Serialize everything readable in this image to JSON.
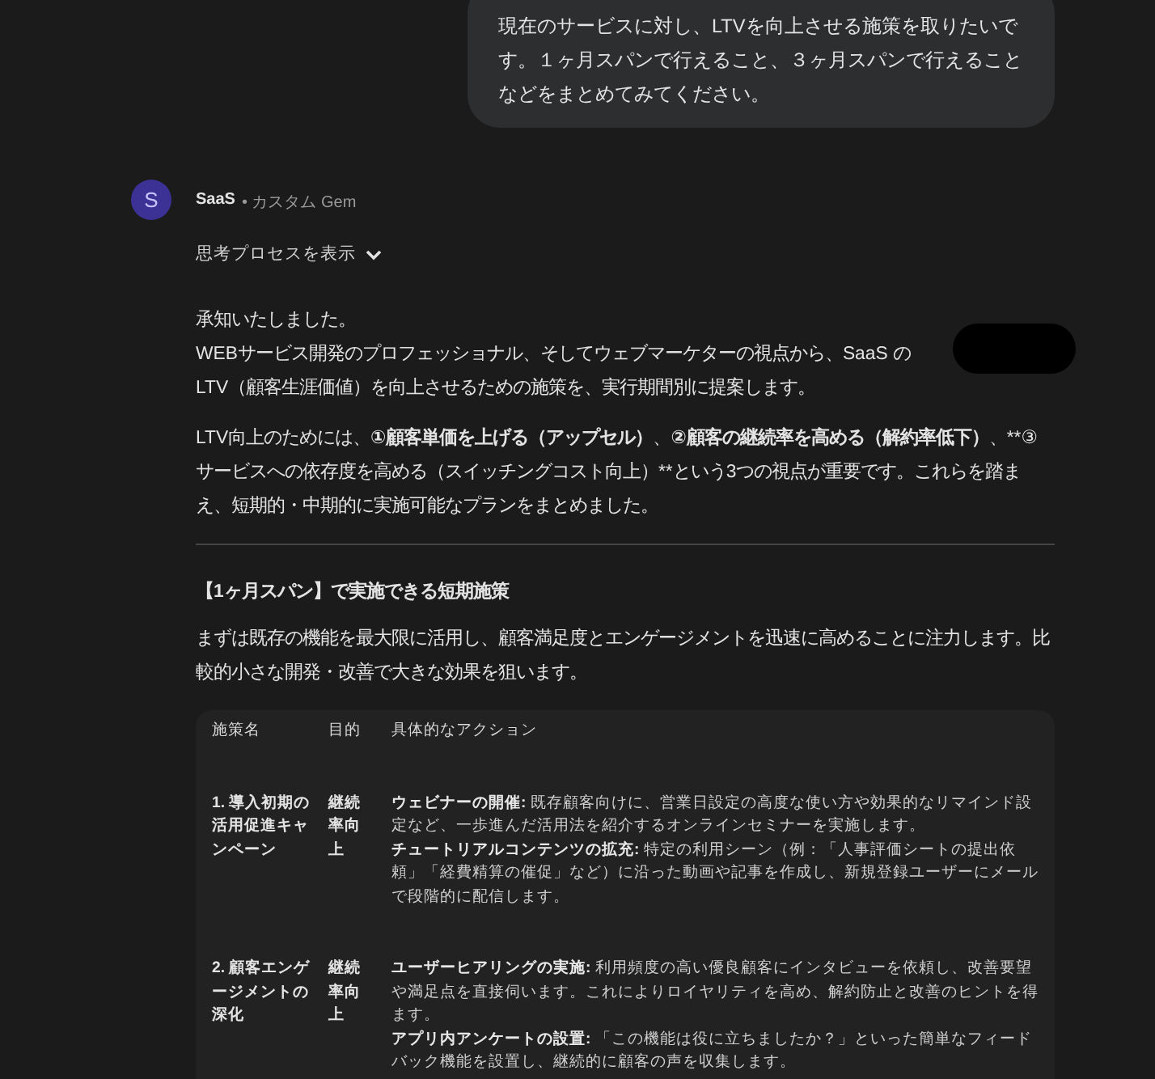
{
  "user_message": "現在のサービスに対し、LTVを向上させる施策を取りたいです。１ヶ月スパンで行えること、３ヶ月スパンで行えることなどをまとめてみてください。",
  "response": {
    "avatar": "S",
    "author": "SaaS",
    "author_suffix": "• カスタム Gem",
    "thinking_toggle": "思考プロセスを表示",
    "thinking_expanded": false,
    "intro": [
      "承知いたしました。",
      "WEBサービス開発のプロフェッショナル、そしてウェブマーケターの視点から、SaaS のLTV（顧客生涯価値）を向上させるための施策を、実行期間別に提案します。"
    ],
    "summary": [
      {
        "text": "LTV向上のためには、",
        "bold": false
      },
      {
        "text": "①顧客単価を上げる（アップセル）",
        "bold": true
      },
      {
        "text": "、",
        "bold": false
      },
      {
        "text": "②顧客の継続率を高める（解約率低下）",
        "bold": true
      },
      {
        "text": "、**③サービスへの依存度を高める（スイッチングコスト向上）**という3つの視点が重要です。これらを踏まえ、短期的・中期的に実施可能なプランをまとめました。",
        "bold": false
      }
    ],
    "section_title": "【1ヶ月スパン】で実施できる短期施策",
    "section_text": "まずは既存の機能を最大限に活用し、顧客満足度とエンゲージメントを迅速に高めることに注力します。比較的小さな開発・改善で大きな効果を狙います。",
    "table": {
      "columns": [
        "施策名",
        "目的",
        "具体的なアクション"
      ],
      "rows": [
        {
          "name": "1. 導入初期の活用促進キャンペーン",
          "purpose": "継続率向上",
          "actions": [
            {
              "title": "ウェビナーの開催:",
              "text": " 既存顧客向けに、営業日設定の高度な使い方や効果的なリマインド設定など、一歩進んだ活用法を紹介するオンラインセミナーを実施します。"
            },
            {
              "title": "チュートリアルコンテンツの拡充:",
              "text": " 特定の利用シーン（例：「人事評価シートの提出依頼」「経費精算の催促」など）に沿った動画や記事を作成し、新規登録ユーザーにメールで段階的に配信します。"
            }
          ]
        },
        {
          "name": "2. 顧客エンゲージメントの深化",
          "purpose": "継続率向上",
          "actions": [
            {
              "title": "ユーザーヒアリングの実施:",
              "text": " 利用頻度の高い優良顧客にインタビューを依頼し、改善要望や満足点を直接伺います。これによりロイヤリティを高め、解約防止と改善のヒントを得ます。"
            },
            {
              "title": "アプリ内アンケートの設置:",
              "text": " 「この機能は役に立ちましたか？」といった簡単なフィードバック機能を設置し、継続的に顧客の声を収集します。"
            }
          ]
        }
      ]
    }
  }
}
